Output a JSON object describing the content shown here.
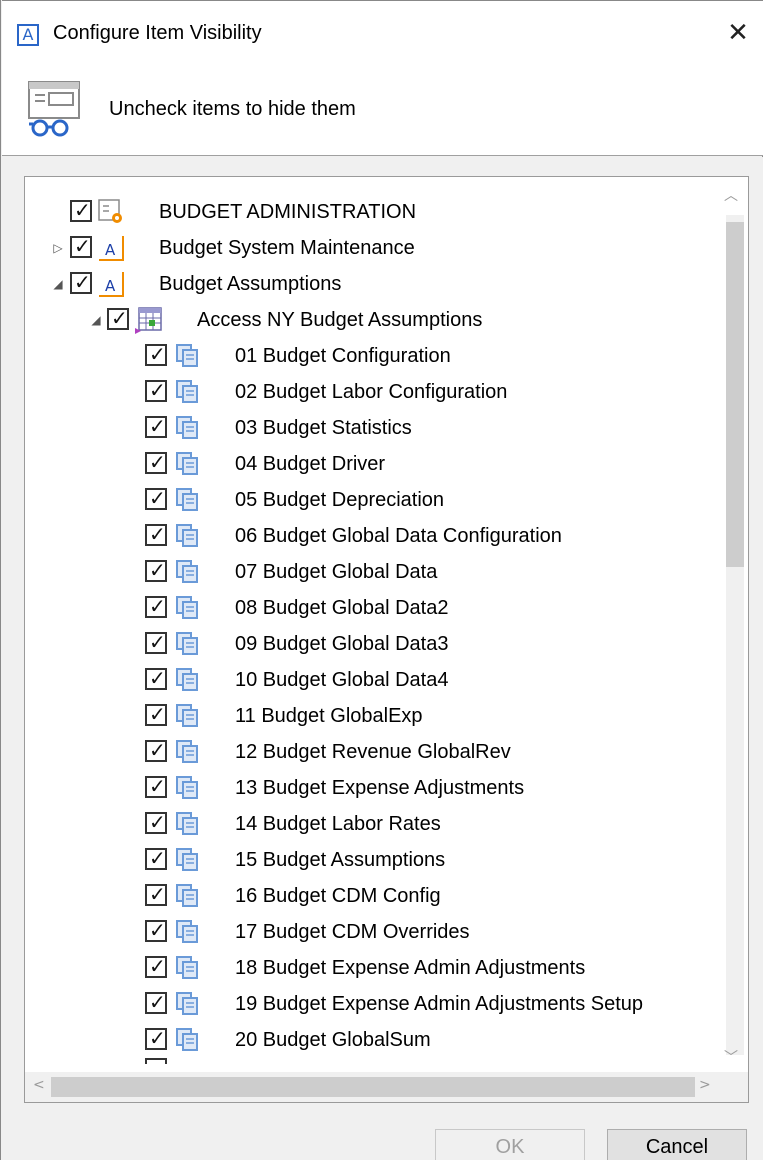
{
  "window": {
    "title": "Configure Item Visibility",
    "app_icon_letter": "A",
    "close_symbol": "✕"
  },
  "header": {
    "instruction": "Uncheck items to hide them",
    "icon": "visibility-glasses-icon"
  },
  "tree": {
    "items": [
      {
        "label": "BUDGET ADMINISTRATION",
        "checked": true,
        "icon": "admin-gear-icon",
        "level": 0,
        "expander": ""
      },
      {
        "label": "Budget System Maintenance",
        "checked": true,
        "icon": "app-a-icon",
        "level": 0,
        "expander": "▷"
      },
      {
        "label": "Budget Assumptions",
        "checked": true,
        "icon": "app-a-icon",
        "level": 0,
        "expander": "◢"
      },
      {
        "label": "Access NY Budget Assumptions",
        "checked": true,
        "icon": "grid-form-icon",
        "level": 1,
        "expander": "◢"
      },
      {
        "label": "01 Budget Configuration",
        "checked": true,
        "icon": "pages-icon",
        "level": 2
      },
      {
        "label": "02 Budget Labor Configuration",
        "checked": true,
        "icon": "pages-icon",
        "level": 2
      },
      {
        "label": "03 Budget Statistics",
        "checked": true,
        "icon": "pages-icon",
        "level": 2
      },
      {
        "label": "04 Budget Driver",
        "checked": true,
        "icon": "pages-icon",
        "level": 2
      },
      {
        "label": "05 Budget Depreciation",
        "checked": true,
        "icon": "pages-icon",
        "level": 2
      },
      {
        "label": "06 Budget Global Data Configuration",
        "checked": true,
        "icon": "pages-icon",
        "level": 2
      },
      {
        "label": "07 Budget Global Data",
        "checked": true,
        "icon": "pages-icon",
        "level": 2
      },
      {
        "label": "08 Budget Global Data2",
        "checked": true,
        "icon": "pages-icon",
        "level": 2
      },
      {
        "label": "09 Budget Global Data3",
        "checked": true,
        "icon": "pages-icon",
        "level": 2
      },
      {
        "label": "10 Budget Global Data4",
        "checked": true,
        "icon": "pages-icon",
        "level": 2
      },
      {
        "label": "11 Budget GlobalExp",
        "checked": true,
        "icon": "pages-icon",
        "level": 2
      },
      {
        "label": "12 Budget Revenue GlobalRev",
        "checked": true,
        "icon": "pages-icon",
        "level": 2
      },
      {
        "label": "13 Budget Expense Adjustments",
        "checked": true,
        "icon": "pages-icon",
        "level": 2
      },
      {
        "label": "14 Budget Labor Rates",
        "checked": true,
        "icon": "pages-icon",
        "level": 2
      },
      {
        "label": "15 Budget Assumptions",
        "checked": true,
        "icon": "pages-icon",
        "level": 2
      },
      {
        "label": "16 Budget CDM Config",
        "checked": true,
        "icon": "pages-icon",
        "level": 2
      },
      {
        "label": "17 Budget CDM Overrides",
        "checked": true,
        "icon": "pages-icon",
        "level": 2
      },
      {
        "label": "18 Budget Expense Admin Adjustments",
        "checked": true,
        "icon": "pages-icon",
        "level": 2
      },
      {
        "label": "19 Budget Expense Admin Adjustments Setup",
        "checked": true,
        "icon": "pages-icon",
        "level": 2
      },
      {
        "label": "20 Budget GlobalSum",
        "checked": true,
        "icon": "pages-icon",
        "level": 2
      }
    ]
  },
  "buttons": {
    "ok_label": "OK",
    "cancel_label": "Cancel"
  },
  "colors": {
    "accent": "#2a66c8",
    "orange": "#f08c00"
  }
}
